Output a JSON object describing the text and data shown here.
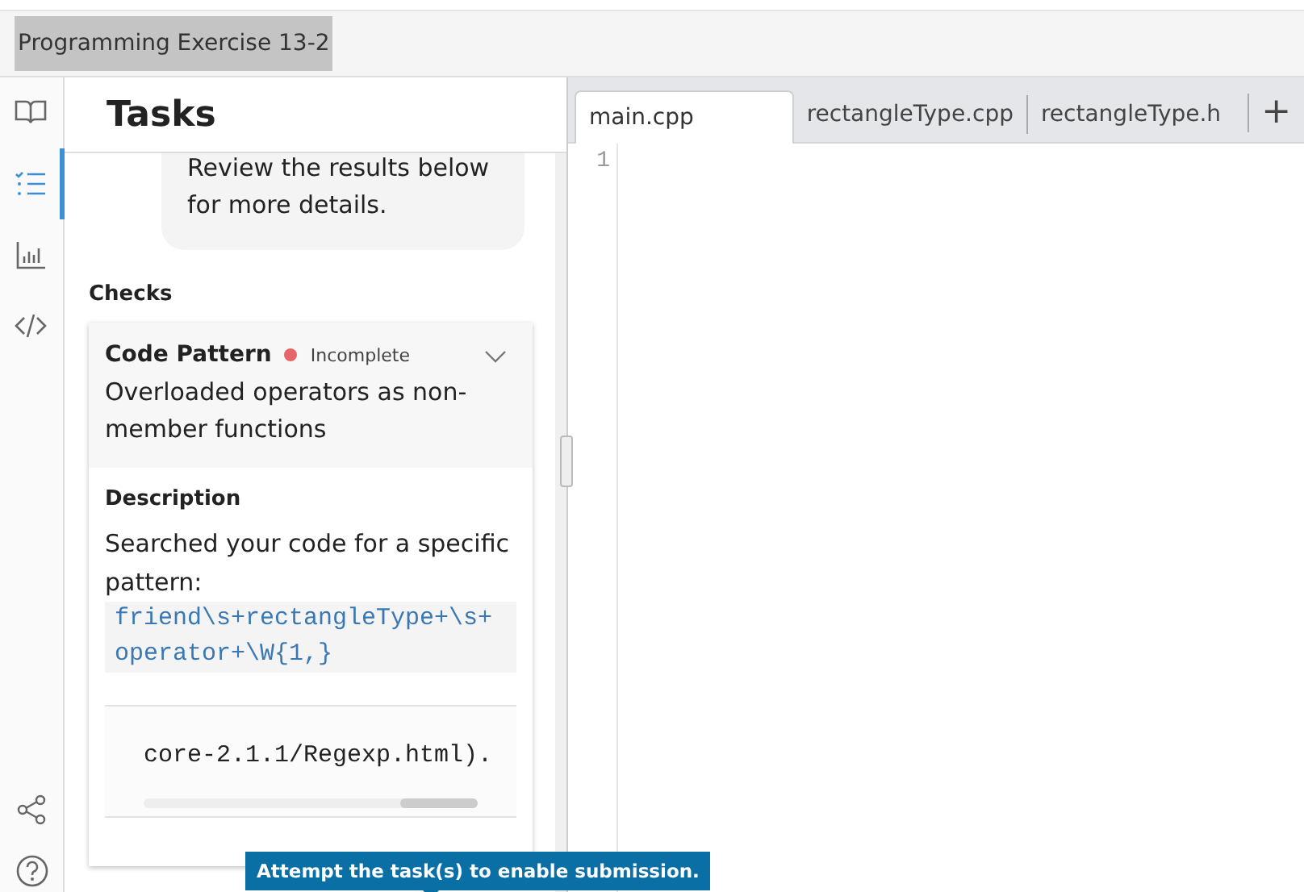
{
  "window": {
    "title": "Programming Exercise 13-2"
  },
  "rail": {
    "items": [
      {
        "kind": "book",
        "selected": false
      },
      {
        "kind": "checklist",
        "selected": true
      },
      {
        "kind": "chart",
        "selected": false
      },
      {
        "kind": "code",
        "selected": false
      }
    ],
    "bottom": [
      {
        "kind": "share"
      },
      {
        "kind": "help"
      }
    ]
  },
  "tasks": {
    "title": "Tasks",
    "message": "Review the results below for more details.",
    "checks_heading": "Checks",
    "checks": [
      {
        "title": "Code Pattern",
        "status": "Incomplete",
        "color": "#e5656b",
        "expanded": true,
        "summary": "Overloaded operators as non-member functions",
        "description_heading": "Description",
        "description": "Searched your code for a specific pattern:",
        "pattern": "friend\\s+rectangleType+\\s+operator+\\W{1,}",
        "snippet": "core-2.1.1/Regexp.html)."
      }
    ]
  },
  "editor": {
    "tabs": [
      {
        "label": "main.cpp",
        "selected": true
      },
      {
        "label": "rectangleType.cpp",
        "selected": false
      },
      {
        "label": "rectangleType.h",
        "selected": false
      }
    ],
    "add_button": "+",
    "line_numbers": [
      "1"
    ]
  },
  "tooltip": "Attempt the task(s) to enable submission."
}
